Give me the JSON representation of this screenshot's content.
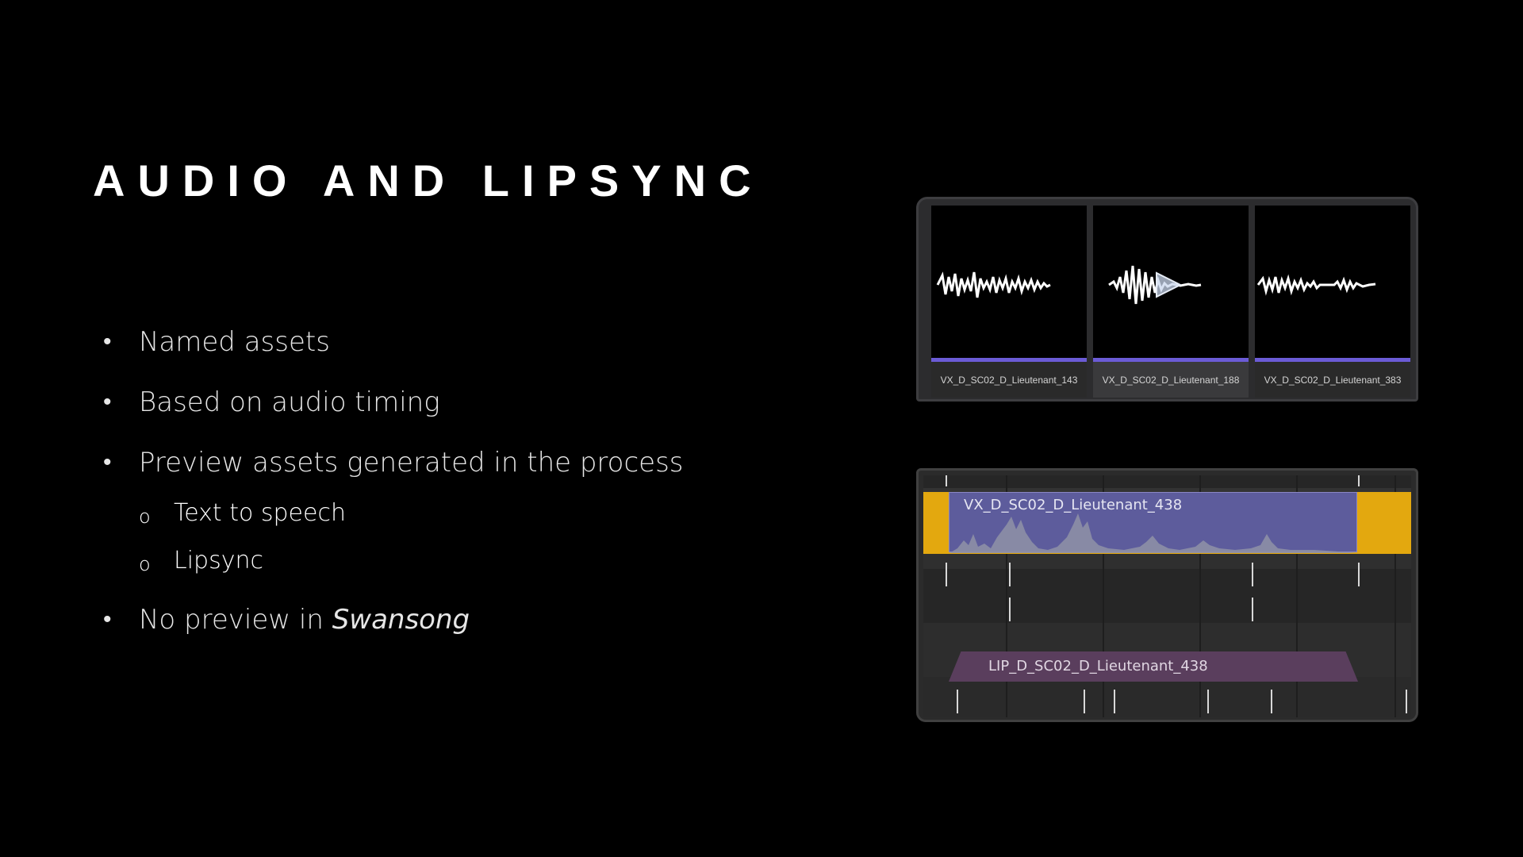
{
  "slide": {
    "title": "AUDIO AND LIPSYNC",
    "bullets": [
      {
        "text": "Named assets"
      },
      {
        "text": "Based on audio timing"
      },
      {
        "text": "Preview assets generated in the process"
      },
      {
        "text": "No preview in ",
        "emphasis": "Swansong"
      }
    ],
    "sub_bullets": [
      "Text to speech",
      "Lipsync"
    ],
    "bullet_glyph": "•",
    "sub_glyph": "o"
  },
  "audio_browser": {
    "assets": [
      {
        "name": "VX_D_SC02_D_Lieutenant_143",
        "selected": false
      },
      {
        "name": "VX_D_SC02_D_Lieutenant_188",
        "selected": true
      },
      {
        "name": "VX_D_SC02_D_Lieutenant_383",
        "selected": false
      }
    ],
    "play_icon": "play-icon",
    "accent": "#6b5bd6"
  },
  "sequencer": {
    "audio_track": {
      "label": "VX_D_SC02_D_Lieutenant_438",
      "color": "#5d5c9c",
      "section_color": "#e3a80f"
    },
    "lip_track": {
      "label": "LIP_D_SC02_D_Lieutenant_438",
      "color": "#5a3e5d"
    }
  }
}
